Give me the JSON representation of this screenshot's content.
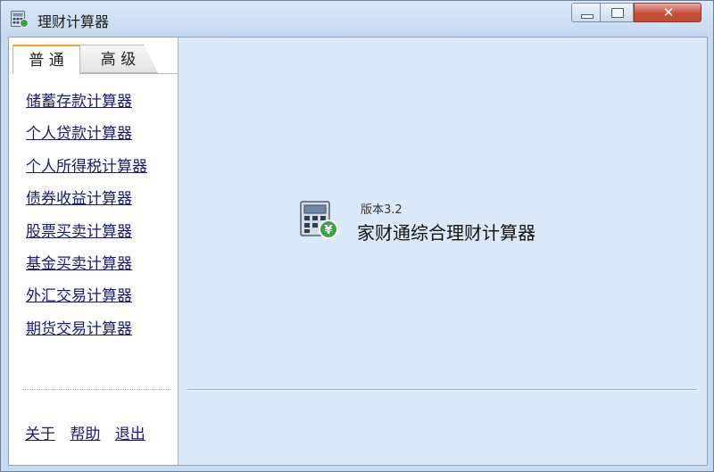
{
  "window": {
    "title": "理财计算器",
    "icons": {
      "app": "calculator-icon",
      "minimize": "minimize-icon",
      "maximize": "maximize-icon",
      "close": "close-icon"
    },
    "close_glyph": "✕"
  },
  "sidebar": {
    "tabs": [
      {
        "label": "普 通"
      },
      {
        "label": "高 级"
      }
    ],
    "active_tab": 0,
    "items": [
      {
        "label": "储蓄存款计算器"
      },
      {
        "label": "个人贷款计算器"
      },
      {
        "label": "个人所得税计算器"
      },
      {
        "label": "债券收益计算器"
      },
      {
        "label": "股票买卖计算器"
      },
      {
        "label": "基金买卖计算器"
      },
      {
        "label": "外汇交易计算器"
      },
      {
        "label": "期货交易计算器"
      }
    ],
    "footer": [
      {
        "label": "关于"
      },
      {
        "label": "帮助"
      },
      {
        "label": "退出"
      }
    ]
  },
  "about": {
    "version": "版本3.2",
    "name": "家财通综合理财计算器",
    "icon": "calculator-yuan-icon"
  },
  "colors": {
    "link": "#1a1a7a",
    "accent_tab": "#f0a630",
    "panel": "#dce9f8"
  }
}
